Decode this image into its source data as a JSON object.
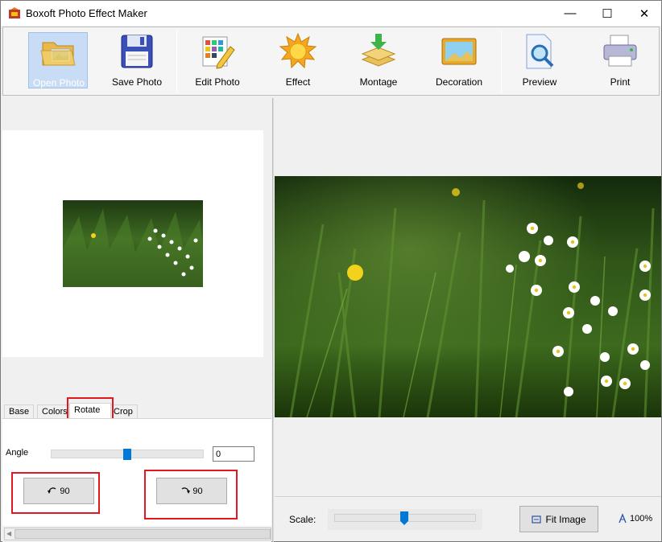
{
  "window": {
    "title": "Boxoft Photo Effect Maker",
    "controls": [
      "—",
      "☐",
      "✕"
    ]
  },
  "toolbar": {
    "items": [
      {
        "label": "Open Photo",
        "icon": "open-folder-icon",
        "active": true
      },
      {
        "label": "Save Photo",
        "icon": "floppy-disk-icon"
      },
      {
        "label": "Edit Photo",
        "icon": "edit-grid-pencil-icon"
      },
      {
        "label": "Effect",
        "icon": "sun-icon"
      },
      {
        "label": "Montage",
        "icon": "layers-arrow-icon"
      },
      {
        "label": "Decoration",
        "icon": "picture-frame-icon"
      },
      {
        "label": "Preview",
        "icon": "magnifier-document-icon"
      },
      {
        "label": "Print",
        "icon": "printer-icon"
      }
    ]
  },
  "tabs": {
    "items": [
      "Base",
      "Colors",
      "Rotate",
      "Crop"
    ],
    "selected": "Rotate"
  },
  "rotate": {
    "angle_label": "Angle",
    "angle_value": "0",
    "slider_fraction": 0.5,
    "rotate_left_label": "90",
    "rotate_right_label": "90"
  },
  "bottom": {
    "scale_label": "Scale:",
    "scale_fraction": 0.5,
    "fit_label": "Fit Image",
    "zoom_label": "100%"
  },
  "colors": {
    "accent": "#0078d7",
    "highlight_box": "#e1191f",
    "active_tool_bg": "#c8dcf5"
  }
}
